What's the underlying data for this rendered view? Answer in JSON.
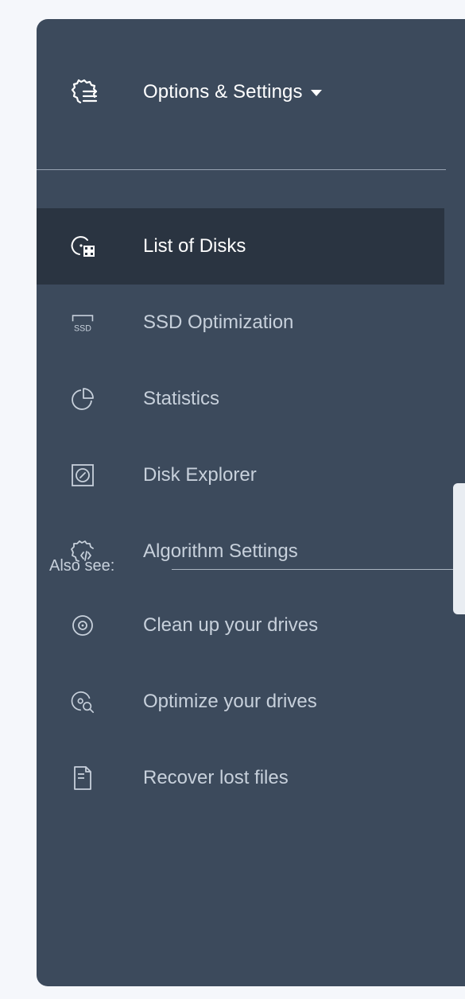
{
  "header": {
    "title": "Options & Settings",
    "title_icon": "gear-list-icon"
  },
  "nav": {
    "items": [
      {
        "label": "List of Disks",
        "icon": "disk-grid-icon",
        "active": true
      },
      {
        "label": "SSD Optimization",
        "icon": "ssd-icon",
        "active": false
      },
      {
        "label": "Statistics",
        "icon": "pie-chart-icon",
        "active": false
      },
      {
        "label": "Disk Explorer",
        "icon": "disk-explorer-icon",
        "active": false
      },
      {
        "label": "Algorithm Settings",
        "icon": "gear-code-icon",
        "active": false
      }
    ]
  },
  "also_see": {
    "label": "Also see:",
    "items": [
      {
        "label": "Clean up your drives",
        "icon": "disc-icon"
      },
      {
        "label": "Optimize your drives",
        "icon": "disc-search-icon"
      },
      {
        "label": "Recover lost files",
        "icon": "document-icon"
      }
    ]
  },
  "colors": {
    "panel_bg": "#3c4a5c",
    "active_bg": "#2a3441",
    "text_active": "#ffffff",
    "text_muted": "#c7d0db"
  }
}
